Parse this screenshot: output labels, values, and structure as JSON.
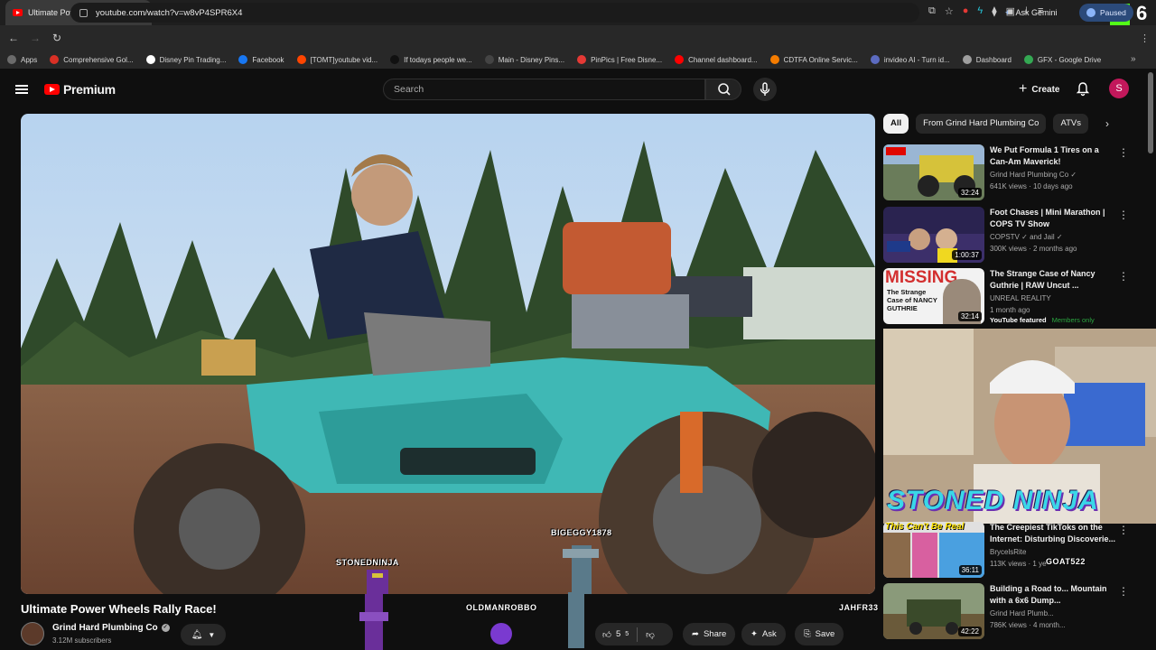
{
  "browser": {
    "tab_title": "Ultimate Power Wheels Rally Race!",
    "gemini_label": "Ask Gemini",
    "url": "youtube.com/watch?v=w8vP4SPR6X4",
    "profile_status": "Paused",
    "kick_count": "6",
    "bookmarks": [
      {
        "label": "Apps",
        "color": "#6b6b6b"
      },
      {
        "label": "Comprehensive Gol...",
        "color": "#d93025"
      },
      {
        "label": "Disney Pin Trading...",
        "color": "#ffffff"
      },
      {
        "label": "Facebook",
        "color": "#1877f2"
      },
      {
        "label": "[TOMT]youtube vid...",
        "color": "#ff4500"
      },
      {
        "label": "If todays people we...",
        "color": "#111111"
      },
      {
        "label": "Main - Disney Pins...",
        "color": "#444444"
      },
      {
        "label": "PinPics | Free Disne...",
        "color": "#e53935"
      },
      {
        "label": "Channel dashboard...",
        "color": "#ff0000"
      },
      {
        "label": "CDTFA Online Servic...",
        "color": "#f57c00"
      },
      {
        "label": "invideo AI - Turn id...",
        "color": "#5c6bc0"
      },
      {
        "label": "Dashboard",
        "color": "#9e9e9e"
      },
      {
        "label": "GFX - Google Drive",
        "color": "#34a853"
      }
    ]
  },
  "header": {
    "brand": "Premium",
    "search_placeholder": "Search",
    "create_label": "Create",
    "avatar_letter": "S"
  },
  "video": {
    "title": "Ultimate Power Wheels Rally Race!",
    "channel": "Grind Hard Plumbing Co",
    "subscribers": "3.12M subscribers",
    "likes": "5",
    "likes_sup": "5",
    "share_label": "Share",
    "ask_label": "Ask",
    "save_label": "Save"
  },
  "overlay": {
    "names": [
      "STONEDNINJA",
      "BIGEGGY1878",
      "OLDMANROBBO",
      "JAHFR33",
      "GOAT522"
    ],
    "stoned_ninja": "STONED NINJA"
  },
  "chips": [
    "All",
    "From Grind Hard Plumbing Co",
    "ATVs"
  ],
  "recommendations": [
    {
      "title": "We Put Formula 1 Tires on a Can-Am Maverick!",
      "channel": "Grind Hard Plumbing Co",
      "meta": "641K views · 10 days ago",
      "duration": "32:24",
      "verified": true
    },
    {
      "title": "Foot Chases | Mini Marathon | COPS TV Show",
      "channel": "COPSTV",
      "channel_extra": "and Jail",
      "meta": "300K views · 2 months ago",
      "duration": "1:00:37",
      "verified": true
    },
    {
      "title": "The Strange Case of Nancy Guthrie | RAW Uncut ...",
      "channel": "UNREAL REALITY",
      "meta": "1 month ago",
      "duration": "32:14",
      "badge_a": "YouTube featured",
      "badge_b": "Members only",
      "thumb_text_a": "MISSING",
      "thumb_text_b": "The Strange Case of NANCY GUTHRIE"
    },
    {
      "title": "The Creepiest TikToks on the Internet: Disturbing Discoverie...",
      "channel": "BrycelsRite",
      "meta": "113K views · 1 ye",
      "duration": "36:11",
      "thumb_text_a": "This Can't Be Real"
    },
    {
      "title": "Building a Road to... Mountain with a 6x6 Dump...",
      "channel": "Grind Hard Plumb...",
      "meta": "786K views · 4 month...",
      "duration": "42:22"
    }
  ]
}
